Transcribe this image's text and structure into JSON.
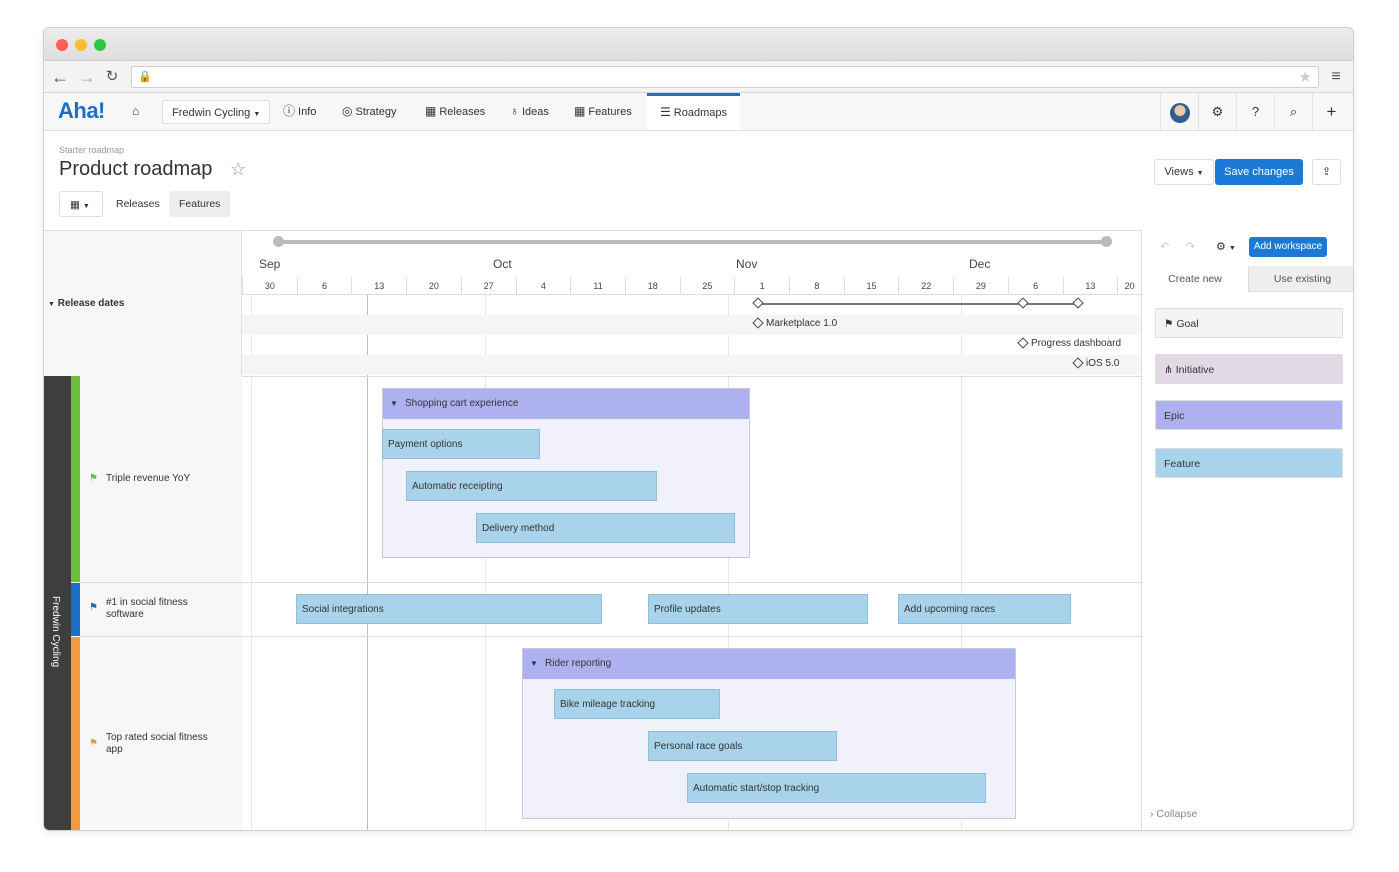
{
  "app": {
    "logo": "Aha!",
    "product": "Fredwin Cycling",
    "nav": [
      {
        "icon": "home-icon",
        "label": ""
      },
      {
        "icon": "info-icon",
        "label": "Info"
      },
      {
        "icon": "target-icon",
        "label": "Strategy"
      },
      {
        "icon": "calendar-icon",
        "label": "Releases"
      },
      {
        "icon": "lightbulb-icon",
        "label": "Ideas"
      },
      {
        "icon": "grid-icon",
        "label": "Features"
      },
      {
        "icon": "roadmap-icon",
        "label": "Roadmaps"
      }
    ],
    "active_nav": "Roadmaps"
  },
  "page": {
    "breadcrumb": "Starter roadmap",
    "title": "Product roadmap",
    "views_label": "Views",
    "save_label": "Save changes",
    "seg_releases": "Releases",
    "seg_features": "Features"
  },
  "timeline": {
    "months": [
      "Sep",
      "Oct",
      "Nov",
      "Dec"
    ],
    "days": [
      "30",
      "6",
      "13",
      "20",
      "27",
      "4",
      "11",
      "18",
      "25",
      "1",
      "8",
      "15",
      "22",
      "29",
      "6",
      "13",
      "20"
    ],
    "release_dates_label": "Release dates",
    "milestones": [
      {
        "label": "Marketplace 1.0"
      },
      {
        "label": "Progress dashboard"
      },
      {
        "label": "iOS 5.0"
      }
    ]
  },
  "workspace": "Fredwin Cycling",
  "goals": [
    {
      "label": "Triple revenue YoY",
      "color": "#6bbf3a"
    },
    {
      "label": "#1 in social fitness software",
      "color": "#1c6fc7"
    },
    {
      "label": "Top rated social fitness app",
      "color": "#f39a3c"
    }
  ],
  "initiatives": [
    {
      "label": "Shopping cart experience"
    },
    {
      "label": "Rider reporting"
    }
  ],
  "features": [
    {
      "label": "Payment options"
    },
    {
      "label": "Automatic receipting"
    },
    {
      "label": "Delivery method"
    },
    {
      "label": "Social integrations"
    },
    {
      "label": "Profile updates"
    },
    {
      "label": "Add upcoming races"
    },
    {
      "label": "Bike mileage tracking"
    },
    {
      "label": "Personal race goals"
    },
    {
      "label": "Automatic start/stop tracking"
    }
  ],
  "sidepanel": {
    "add_workspace": "Add workspace",
    "tab_create": "Create new",
    "tab_existing": "Use existing",
    "cards": [
      {
        "label": "Goal",
        "color": "#f3f3f3"
      },
      {
        "label": "Initiative",
        "color": "#e3d8e6"
      },
      {
        "label": "Epic",
        "color": "#aeb1ef"
      },
      {
        "label": "Feature",
        "color": "#a9d3eb"
      }
    ],
    "collapse": "Collapse"
  }
}
